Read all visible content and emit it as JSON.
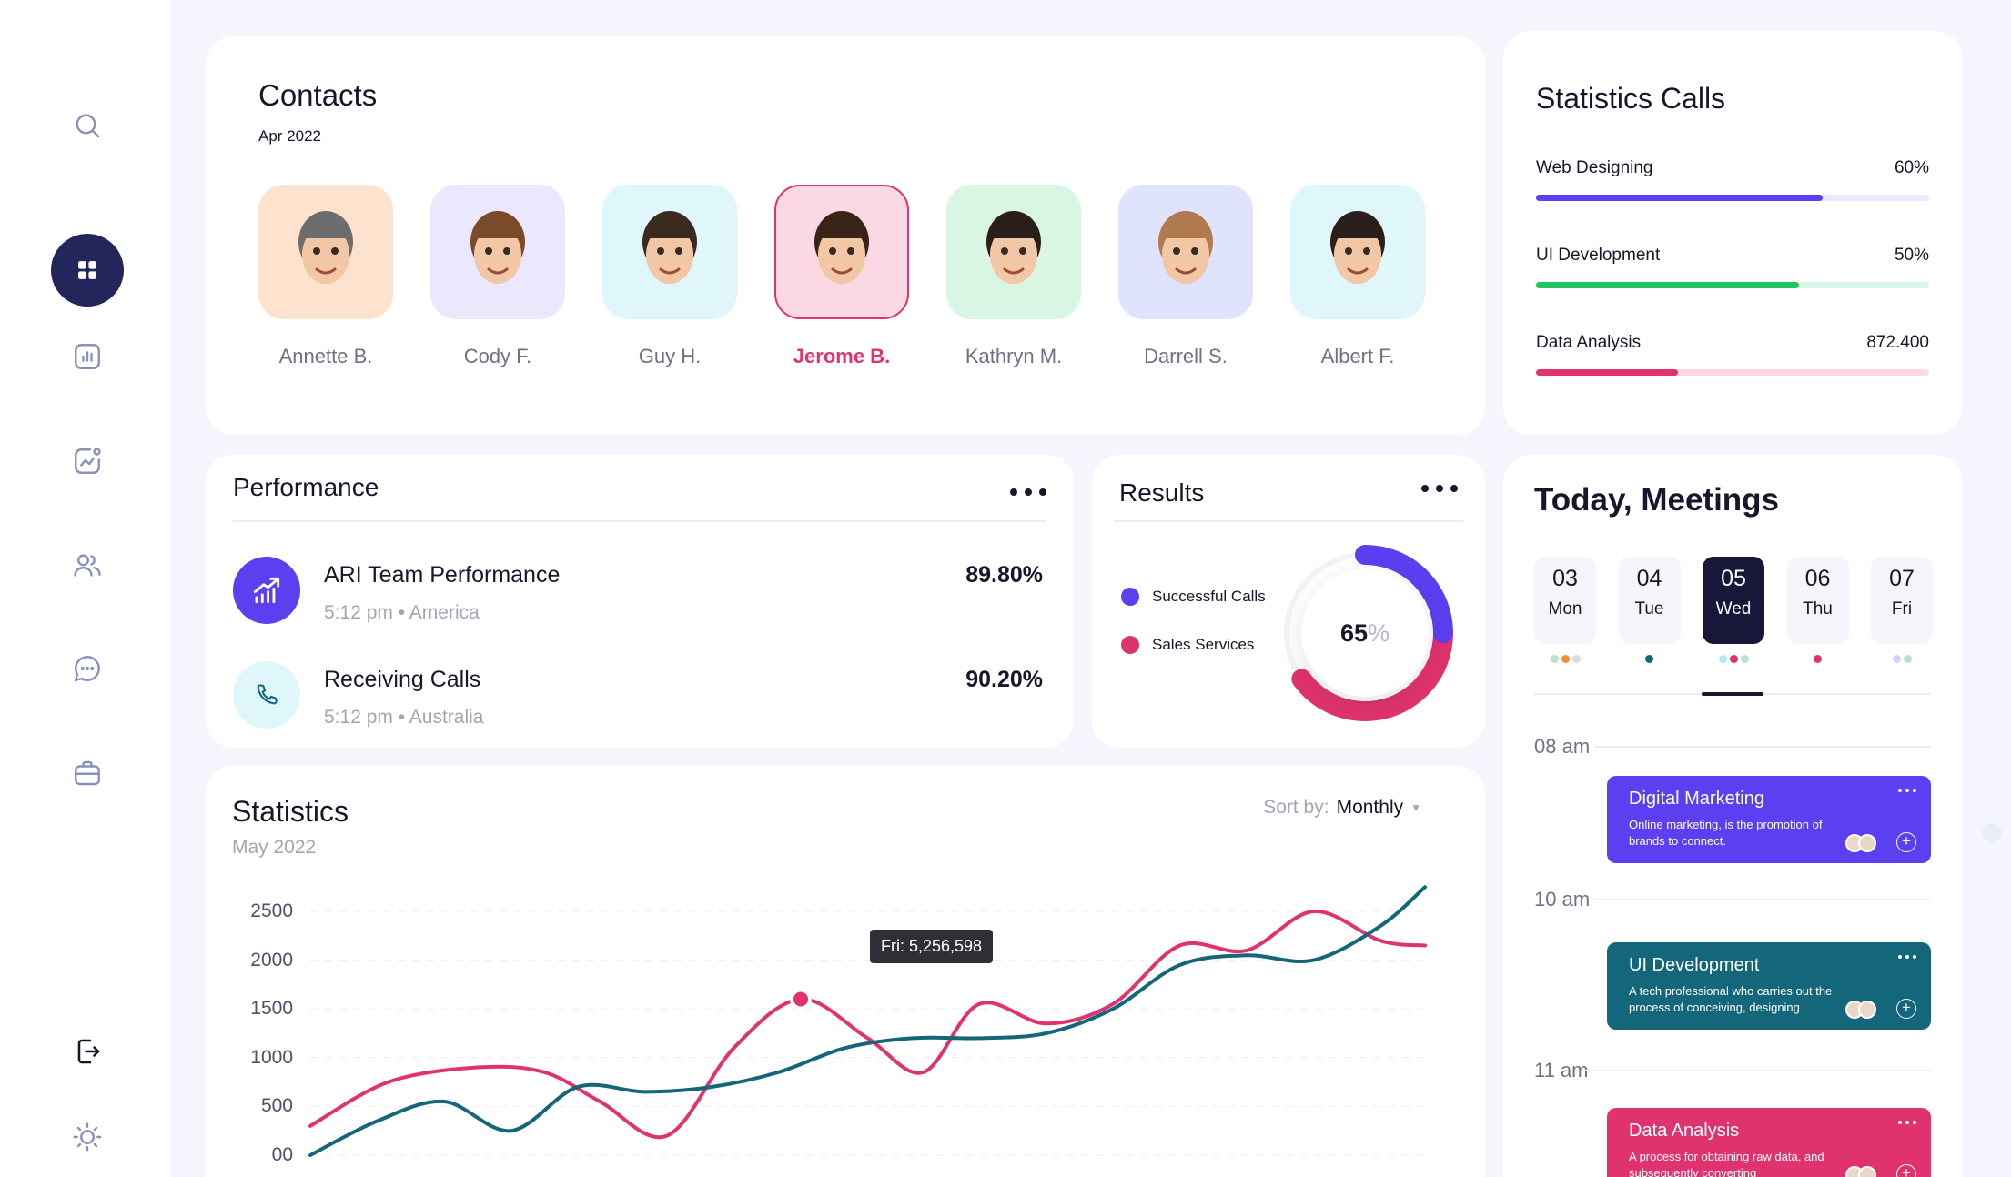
{
  "sidebar": {
    "items": [
      {
        "name": "search",
        "icon": "search-icon"
      },
      {
        "name": "dashboard",
        "icon": "grid-icon",
        "active": true
      },
      {
        "name": "reports",
        "icon": "bar-chart-icon"
      },
      {
        "name": "analytics",
        "icon": "line-chart-icon"
      },
      {
        "name": "contacts",
        "icon": "users-icon"
      },
      {
        "name": "messages",
        "icon": "chat-icon"
      },
      {
        "name": "portfolio",
        "icon": "briefcase-icon"
      }
    ],
    "bottom": [
      {
        "name": "logout",
        "icon": "logout-icon"
      },
      {
        "name": "theme",
        "icon": "sun-icon"
      }
    ]
  },
  "contacts": {
    "title": "Contacts",
    "subtitle": "Apr 2022",
    "people": [
      {
        "name": "Annette B.",
        "bg": "#fde3cd"
      },
      {
        "name": "Cody F.",
        "bg": "#ebe7fd"
      },
      {
        "name": "Guy H.",
        "bg": "#dff6fb"
      },
      {
        "name": "Jerome B.",
        "bg": "#fcd7e4",
        "active": true
      },
      {
        "name": "Kathryn M.",
        "bg": "#d9f5e3"
      },
      {
        "name": "Darrell S.",
        "bg": "#dfe3fd"
      },
      {
        "name": "Albert F.",
        "bg": "#dff6fb"
      }
    ]
  },
  "performance": {
    "title": "Performance",
    "rows": [
      {
        "name": "ARI Team Performance",
        "time": "5:12 pm",
        "location": "America",
        "value": "89.80%",
        "icon": "trending-up-icon"
      },
      {
        "name": "Receiving Calls",
        "time": "5:12 pm",
        "location": "Australia",
        "value": "90.20%",
        "icon": "phone-icon"
      }
    ]
  },
  "results": {
    "title": "Results",
    "legend": [
      {
        "label": "Successful Calls",
        "color": "#5b3ff0"
      },
      {
        "label": "Sales Services",
        "color": "#e0336d"
      }
    ],
    "center_value": "65",
    "center_unit": "%",
    "segments": [
      25,
      40
    ]
  },
  "statistics": {
    "title": "Statistics",
    "subtitle": "May 2022",
    "sort_label": "Sort by:",
    "sort_value": "Monthly",
    "tooltip": "Fri: 5,256,598"
  },
  "chart_data": {
    "type": "line",
    "y_ticks": [
      "2500",
      "2000",
      "1500",
      "1000",
      "500",
      "00"
    ],
    "ylim": [
      0,
      2500
    ],
    "grid": true,
    "series": [
      {
        "color": "#e0336d",
        "x": [
          0,
          0.07,
          0.15,
          0.21,
          0.26,
          0.32,
          0.38,
          0.44,
          0.5,
          0.55,
          0.6,
          0.66,
          0.72,
          0.78,
          0.84,
          0.9,
          0.96,
          1.0
        ],
        "values": [
          300,
          750,
          900,
          850,
          550,
          200,
          1100,
          1600,
          1200,
          850,
          1550,
          1350,
          1550,
          2150,
          2100,
          2500,
          2200,
          2150
        ]
      },
      {
        "color": "#14667a",
        "x": [
          0,
          0.06,
          0.12,
          0.18,
          0.24,
          0.3,
          0.36,
          0.42,
          0.48,
          0.54,
          0.6,
          0.66,
          0.72,
          0.78,
          0.84,
          0.9,
          0.96,
          1.0
        ],
        "values": [
          0,
          350,
          550,
          250,
          700,
          650,
          700,
          850,
          1100,
          1200,
          1200,
          1250,
          1500,
          1950,
          2050,
          2000,
          2350,
          2750
        ]
      }
    ],
    "highlight": {
      "series": 0,
      "x": 0.44,
      "value": 1600
    }
  },
  "calls": {
    "title": "Statistics Calls",
    "rows": [
      {
        "label": "Web Designing",
        "value": "60%",
        "fill": 0.73,
        "color": "#5b3ff0",
        "track": "#ebe7fd"
      },
      {
        "label": "UI Development",
        "value": "50%",
        "fill": 0.67,
        "color": "#22c55e",
        "track": "#dcf7e7"
      },
      {
        "label": "Data Analysis",
        "value": "872.400",
        "fill": 0.36,
        "color": "#e0336d",
        "track": "#fcd7e4"
      }
    ]
  },
  "meetings": {
    "title": "Today, Meetings",
    "days": [
      {
        "num": "03",
        "label": "Mon",
        "dots": [
          "#b7e3c6",
          "#f28c3b",
          "#d9dbe6"
        ]
      },
      {
        "num": "04",
        "label": "Tue",
        "dots": [
          "#14667a"
        ]
      },
      {
        "num": "05",
        "label": "Wed",
        "active": true,
        "dots": [
          "#b4e8f0",
          "#e0336d",
          "#b7e3c6"
        ]
      },
      {
        "num": "06",
        "label": "Thu",
        "dots": [
          "#e0336d"
        ]
      },
      {
        "num": "07",
        "label": "Fri",
        "dots": [
          "#d3d3f7",
          "#b7e3c6"
        ]
      }
    ],
    "times": [
      "08 am",
      "10 am",
      "11 am"
    ],
    "events": [
      {
        "title": "Digital Marketing",
        "desc": "Online marketing, is the promotion of brands to connect.",
        "color": "#5b3ff0"
      },
      {
        "title": "UI Development",
        "desc": "A tech professional who carries out the process of conceiving, designing",
        "color": "#14667a"
      },
      {
        "title": "Data Analysis",
        "desc": "A process for obtaining raw data, and subsequently converting",
        "color": "#e0336d"
      }
    ]
  }
}
